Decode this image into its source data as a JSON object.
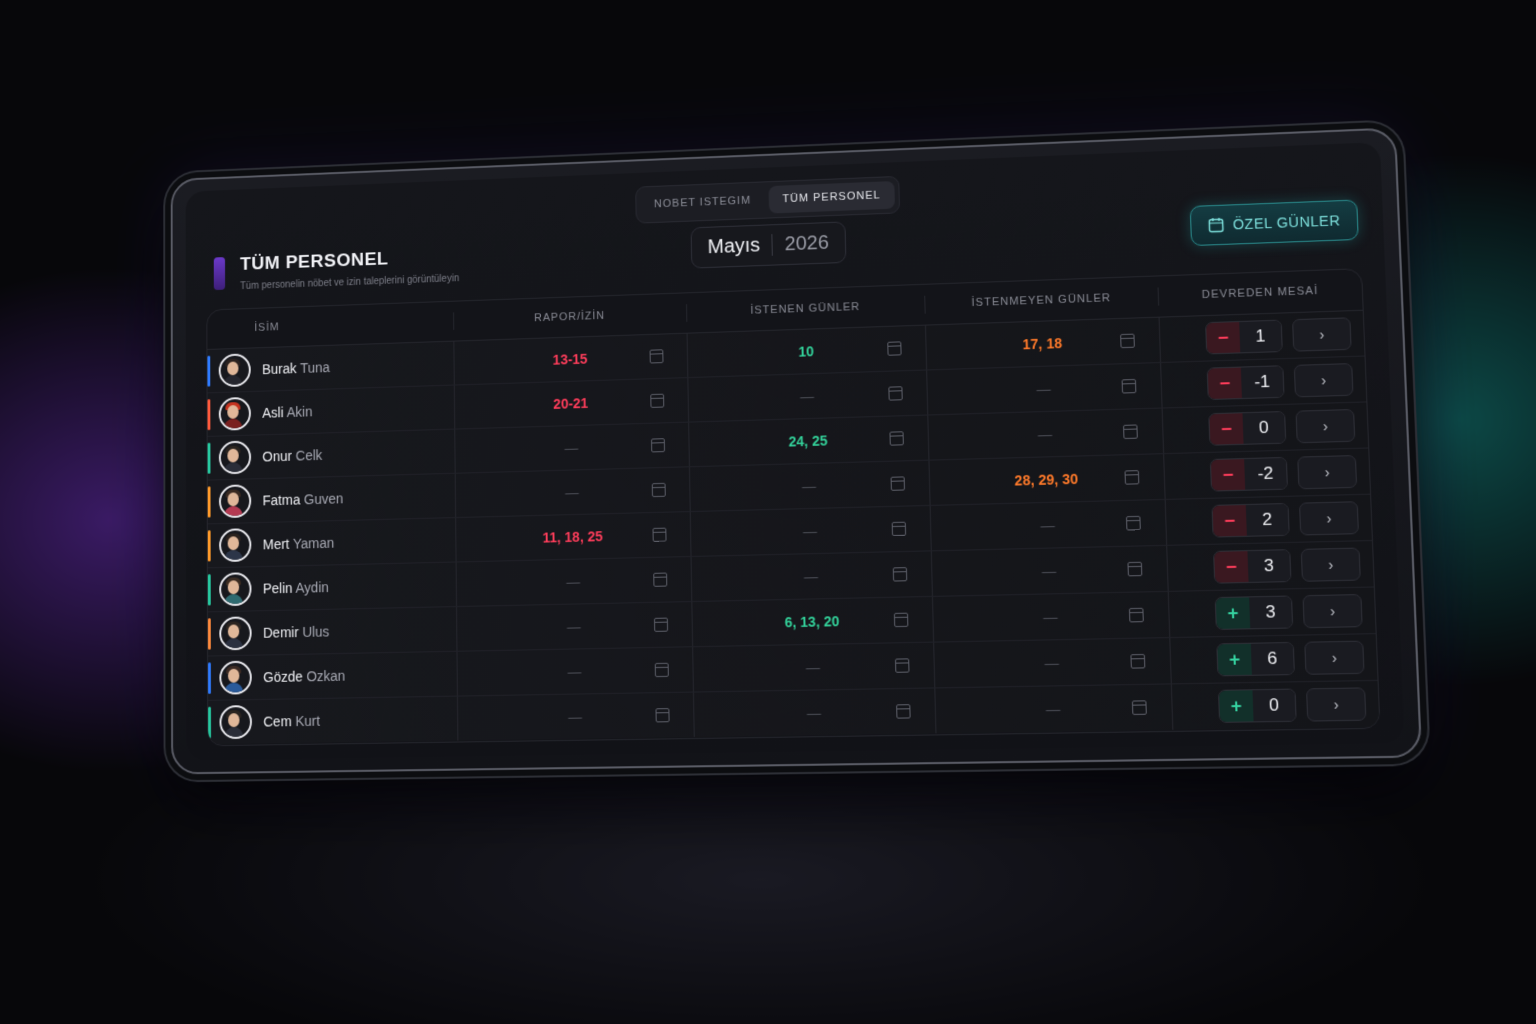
{
  "tabs": [
    {
      "label": "NOBET ISTEGIM",
      "active": false
    },
    {
      "label": "TÜM PERSONEL",
      "active": true
    }
  ],
  "header": {
    "title": "TÜM PERSONEL",
    "subtitle": "Tüm personelin nöbet ve izin taleplerini görüntüleyin",
    "month": "Mayıs",
    "year": "2026",
    "special_days_label": "ÖZEL GÜNLER"
  },
  "table": {
    "columns": [
      "İSİM",
      "RAPOR/İZİN",
      "İSTENEN GÜNLER",
      "İSTENMEYEN GÜNLER",
      "DEVREDEN MESAİ"
    ],
    "rows": [
      {
        "first": "Burak",
        "last": "Tuna",
        "stripe": "#2f7bff",
        "hair": "#2b2220",
        "shirt": "#25262e",
        "report": "13-15",
        "requested": "10",
        "unwanted": "17, 18",
        "sign": "−",
        "carry": "1"
      },
      {
        "first": "Asli",
        "last": "Akin",
        "stripe": "#ff5a3d",
        "hair": "#c4331f",
        "shirt": "#7a2020",
        "report": "20-21",
        "requested": "—",
        "unwanted": "—",
        "sign": "−",
        "carry": "-1"
      },
      {
        "first": "Onur",
        "last": "Celk",
        "stripe": "#27c9a0",
        "hair": "#2a2420",
        "shirt": "#2a2d38",
        "report": "—",
        "requested": "24, 25",
        "unwanted": "—",
        "sign": "−",
        "carry": "0"
      },
      {
        "first": "Fatma",
        "last": "Guven",
        "stripe": "#ff9a2a",
        "hair": "#3a2a22",
        "shirt": "#b43a52",
        "report": "—",
        "requested": "—",
        "unwanted": "28, 29, 30",
        "sign": "−",
        "carry": "-2"
      },
      {
        "first": "Mert",
        "last": "Yaman",
        "stripe": "#ff9a2a",
        "hair": "#2a221e",
        "shirt": "#2c3548",
        "report": "11, 18, 25",
        "requested": "—",
        "unwanted": "—",
        "sign": "−",
        "carry": "2"
      },
      {
        "first": "Pelin",
        "last": "Aydin",
        "stripe": "#27c9a0",
        "hair": "#3b2c22",
        "shirt": "#2e6a70",
        "report": "—",
        "requested": "—",
        "unwanted": "—",
        "sign": "−",
        "carry": "3"
      },
      {
        "first": "Demir",
        "last": "Ulus",
        "stripe": "#ff8a3d",
        "hair": "#2b2420",
        "shirt": "#2a3040",
        "report": "—",
        "requested": "6, 13, 20",
        "unwanted": "—",
        "sign": "+",
        "carry": "3"
      },
      {
        "first": "Gözde",
        "last": "Ozkan",
        "stripe": "#2f7bff",
        "hair": "#3a2a24",
        "shirt": "#2a5a9a",
        "report": "—",
        "requested": "—",
        "unwanted": "—",
        "sign": "+",
        "carry": "6"
      },
      {
        "first": "Cem",
        "last": "Kurt",
        "stripe": "#27c9a0",
        "hair": "#2a2420",
        "shirt": "#2a2d38",
        "report": "—",
        "requested": "—",
        "unwanted": "—",
        "sign": "+",
        "carry": "0"
      }
    ],
    "icons": {
      "calendar": "calendar-icon",
      "next": "chevron-right-icon"
    },
    "colors": {
      "report": "#ff3d5b",
      "requested": "#33d19a",
      "unwanted": "#ff7a2a"
    }
  }
}
